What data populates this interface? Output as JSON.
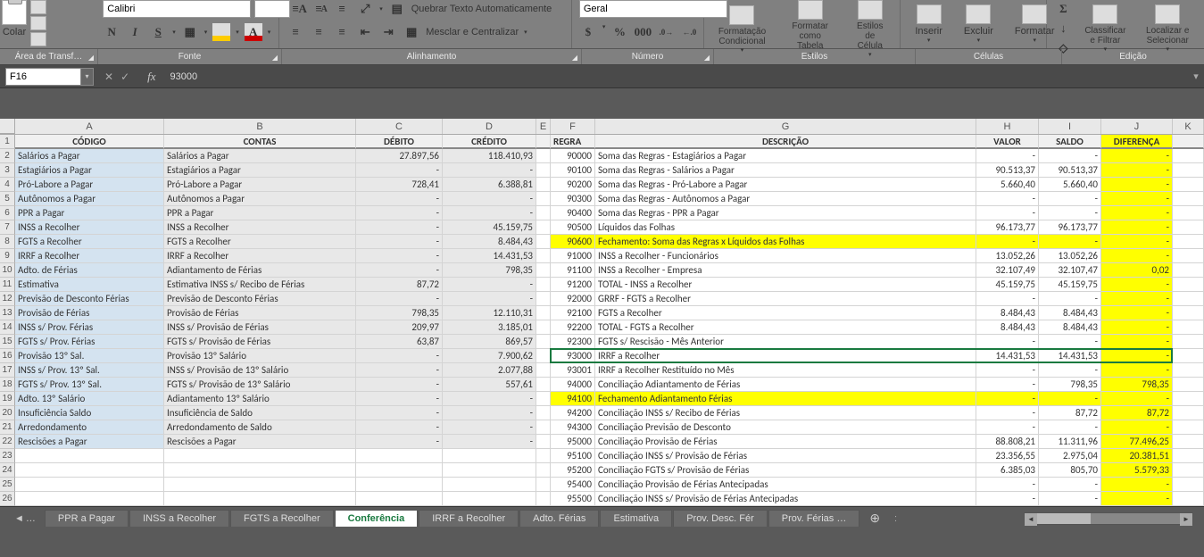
{
  "ribbon": {
    "paste_label": "Colar",
    "font_name": "Calibri",
    "font_controls": {
      "bold": "N",
      "italic": "I",
      "underline": "S"
    },
    "wrap_text": "Quebrar Texto Automaticamente",
    "merge_center": "Mesclar e Centralizar",
    "number_format": "Geral",
    "cond_format": "Formatação Condicional",
    "format_table": "Formatar como Tabela",
    "cell_styles": "Estilos de Célula",
    "insert": "Inserir",
    "delete": "Excluir",
    "format": "Formatar",
    "sort_filter": "Classificar e Filtrar",
    "find_select": "Localizar e Selecionar",
    "arrow": "▾"
  },
  "groups": {
    "clipboard": "Área de Transf…",
    "font": "Fonte",
    "alignment": "Alinhamento",
    "number": "Número",
    "styles": "Estilos",
    "cells": "Células",
    "editing": "Edição"
  },
  "formula_bar": {
    "name_box": "F16",
    "value": "93000",
    "fx": "fx"
  },
  "columns": {
    "A": "CÓDIGO",
    "B": "CONTAS",
    "C": "DÉBITO",
    "D": "CRÉDITO",
    "E": "",
    "F": "REGRA",
    "G": "DESCRIÇÃO",
    "H": "VALOR",
    "I": "SALDO",
    "J": "DIFERENÇA"
  },
  "col_letters": [
    "A",
    "B",
    "C",
    "D",
    "E",
    "F",
    "G",
    "H",
    "I",
    "J",
    "K"
  ],
  "left_rows": [
    {
      "a": "Salários a Pagar",
      "b": "Salários a Pagar",
      "c": "27.897,56",
      "d": "118.410,93"
    },
    {
      "a": "Estagiários a Pagar",
      "b": "Estagiários a Pagar",
      "c": "-",
      "d": "-"
    },
    {
      "a": "Pró-Labore a Pagar",
      "b": "Pró-Labore a Pagar",
      "c": "728,41",
      "d": "6.388,81"
    },
    {
      "a": "Autônomos a Pagar",
      "b": "Autônomos a Pagar",
      "c": "-",
      "d": "-"
    },
    {
      "a": "PPR a Pagar",
      "b": "PPR a Pagar",
      "c": "-",
      "d": "-"
    },
    {
      "a": "INSS a Recolher",
      "b": "INSS a Recolher",
      "c": "-",
      "d": "45.159,75"
    },
    {
      "a": "FGTS a Recolher",
      "b": "FGTS a Recolher",
      "c": "-",
      "d": "8.484,43"
    },
    {
      "a": "IRRF a Recolher",
      "b": "IRRF a Recolher",
      "c": "-",
      "d": "14.431,53"
    },
    {
      "a": "Adto. de Férias",
      "b": "Adiantamento de Férias",
      "c": "-",
      "d": "798,35"
    },
    {
      "a": "Estimativa",
      "b": "Estimativa  INSS s/ Recibo de Férias",
      "c": "87,72",
      "d": "-"
    },
    {
      "a": "Previsão de  Desconto Férias",
      "b": "Previsão de  Desconto Férias",
      "c": "-",
      "d": "-"
    },
    {
      "a": "Provisão de Férias",
      "b": "Provisão de Férias",
      "c": "798,35",
      "d": "12.110,31"
    },
    {
      "a": "INSS s/ Prov. Férias",
      "b": "INSS s/ Provisão de Férias",
      "c": "209,97",
      "d": "3.185,01"
    },
    {
      "a": "FGTS s/ Prov. Férias",
      "b": "FGTS s/ Provisão de Férias",
      "c": "63,87",
      "d": "869,57"
    },
    {
      "a": "Provisão 13º Sal.",
      "b": "Provisão 13º Salário",
      "c": "-",
      "d": "7.900,62"
    },
    {
      "a": "INSS s/ Prov. 13º Sal.",
      "b": "INSS s/ Provisão de 13º Salário",
      "c": "-",
      "d": "2.077,88"
    },
    {
      "a": "FGTS s/ Prov. 13º Sal.",
      "b": "FGTS s/ Provisão de 13º Salário",
      "c": "-",
      "d": "557,61"
    },
    {
      "a": "Adto. 13º Salário",
      "b": "Adiantamento 13º Salário",
      "c": "-",
      "d": "-"
    },
    {
      "a": "Insuficiência Saldo",
      "b": "Insuficiência de Saldo",
      "c": "-",
      "d": "-"
    },
    {
      "a": "Arredondamento",
      "b": "Arredondamento de Saldo",
      "c": "-",
      "d": "-"
    },
    {
      "a": "Rescisões a Pagar",
      "b": "Rescisões a Pagar",
      "c": "-",
      "d": "-"
    }
  ],
  "right_rows": [
    {
      "f": "90000",
      "g": "Soma das Regras - Estagiários a Pagar",
      "h": "-",
      "i": "-",
      "j": "-"
    },
    {
      "f": "90100",
      "g": "Soma das Regras - Salários a Pagar",
      "h": "90.513,37",
      "i": "90.513,37",
      "j": "-"
    },
    {
      "f": "90200",
      "g": "Soma das Regras - Pró-Labore a Pagar",
      "h": "5.660,40",
      "i": "5.660,40",
      "j": "-"
    },
    {
      "f": "90300",
      "g": "Soma das Regras - Autônomos a Pagar",
      "h": "-",
      "i": "-",
      "j": "-"
    },
    {
      "f": "90400",
      "g": "Soma das Regras - PPR a Pagar",
      "h": "-",
      "i": "-",
      "j": "-"
    },
    {
      "f": "90500",
      "g": "Líquidos das Folhas",
      "h": "96.173,77",
      "i": "96.173,77",
      "j": "-"
    },
    {
      "f": "90600",
      "g": "Fechamento: Soma das Regras x Líquidos das Folhas",
      "h": "-",
      "i": "-",
      "j": "-",
      "yellow": true
    },
    {
      "f": "91000",
      "g": "INSS a Recolher - Funcionários",
      "h": "13.052,26",
      "i": "13.052,26",
      "j": "-"
    },
    {
      "f": "91100",
      "g": "INSS a Recolher - Empresa",
      "h": "32.107,49",
      "i": "32.107,47",
      "j": "0,02"
    },
    {
      "f": "91200",
      "g": "TOTAL - INSS a Recolher",
      "h": "45.159,75",
      "i": "45.159,75",
      "j": "-"
    },
    {
      "f": "92000",
      "g": "GRRF - FGTS a Recolher",
      "h": "-",
      "i": "-",
      "j": "-"
    },
    {
      "f": "92100",
      "g": "FGTS a Recolher",
      "h": "8.484,43",
      "i": "8.484,43",
      "j": "-"
    },
    {
      "f": "92200",
      "g": "TOTAL - FGTS a Recolher",
      "h": "8.484,43",
      "i": "8.484,43",
      "j": "-"
    },
    {
      "f": "92300",
      "g": "FGTS s/ Rescisão - Mês Anterior",
      "h": "-",
      "i": "-",
      "j": "-"
    },
    {
      "f": "93000",
      "g": "IRRF a Recolher",
      "h": "14.431,53",
      "i": "14.431,53",
      "j": "-"
    },
    {
      "f": "93001",
      "g": "IRRF a Recolher Restituído no Mês",
      "h": "-",
      "i": "-",
      "j": "-"
    },
    {
      "f": "94000",
      "g": "Conciliação Adiantamento de Férias",
      "h": "-",
      "i": "798,35",
      "j": "798,35"
    },
    {
      "f": "94100",
      "g": "Fechamento Adiantamento Férias",
      "h": "-",
      "i": "-",
      "j": "-",
      "yellow": true
    },
    {
      "f": "94200",
      "g": "Conciliação INSS s/ Recibo de Férias",
      "h": "-",
      "i": "87,72",
      "j": "87,72"
    },
    {
      "f": "94300",
      "g": "Conciliação Previsão de Desconto",
      "h": "-",
      "i": "-",
      "j": "-"
    },
    {
      "f": "95000",
      "g": "Conciliação Provisão de Férias",
      "h": "88.808,21",
      "i": "11.311,96",
      "j": "77.496,25"
    },
    {
      "f": "95100",
      "g": "Conciliação INSS s/ Provisão de Férias",
      "h": "23.356,55",
      "i": "2.975,04",
      "j": "20.381,51"
    },
    {
      "f": "95200",
      "g": "Conciliação FGTS s/ Provisão de Férias",
      "h": "6.385,03",
      "i": "805,70",
      "j": "5.579,33"
    },
    {
      "f": "95400",
      "g": "Conciliação Provisão de Férias Antecipadas",
      "h": "-",
      "i": "-",
      "j": "-"
    },
    {
      "f": "95500",
      "g": "Conciliação INSS s/ Provisão de Férias Antecipadas",
      "h": "-",
      "i": "-",
      "j": "-"
    }
  ],
  "tabs": {
    "list": [
      "PPR a Pagar",
      "INSS a Recolher",
      "FGTS a Recolher",
      "Conferência",
      "IRRF a Recolher",
      "Adto. Férias",
      "Estimativa",
      "Prov. Desc. Fér",
      "Prov. Férias …"
    ],
    "active": "Conferência",
    "nav_prev": "◄",
    "nav_more": "…",
    "separator": ":",
    "add": "⊕"
  },
  "col_widths": {
    "A": 167,
    "B": 215,
    "C": 97,
    "D": 105,
    "E": 16,
    "F": 50,
    "G": 427,
    "H": 70,
    "I": 70,
    "J": 80,
    "K": 35
  }
}
